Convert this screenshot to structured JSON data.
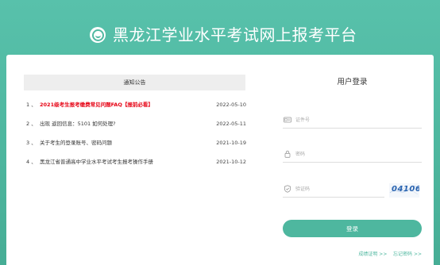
{
  "header": {
    "title": "黑龙江学业水平考试网上报考平台",
    "logo_icon": "platform-emblem-icon"
  },
  "notice": {
    "heading": "通知公告",
    "items": [
      {
        "index": "1 、",
        "title": "2021级考生报考缴费常见问题FAQ【报前必看】",
        "date": "2022-05-10",
        "highlight": true
      },
      {
        "index": "2 、",
        "title": "出现 返回信息：5101 如何处理?",
        "date": "2022-05-11",
        "highlight": false
      },
      {
        "index": "3 、",
        "title": "关于考生的登录账号、密码问题",
        "date": "2021-10-19",
        "highlight": false
      },
      {
        "index": "4 、",
        "title": "黑龙江省普通高中学业水平考试考生报考操作手册",
        "date": "2021-10-12",
        "highlight": false
      }
    ]
  },
  "login": {
    "title": "用户登录",
    "id_placeholder": "证件号",
    "password_placeholder": "密码",
    "captcha_placeholder": "验证码",
    "captcha_text": "04106",
    "submit_label": "登录",
    "link_scores": "成绩证明 >>",
    "link_forgot": "忘记密码 >>"
  },
  "colors": {
    "brand": "#4eb79f",
    "notice_highlight": "#e60012",
    "captcha_text": "#2a64b0"
  }
}
